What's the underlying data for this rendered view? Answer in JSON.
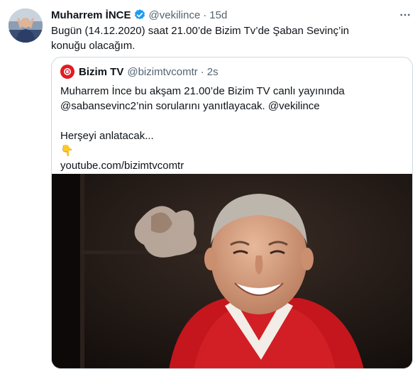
{
  "tweet": {
    "author_name": "Muharrem İNCE",
    "author_handle": "@vekilince",
    "separator": "·",
    "time": "15d",
    "text": "Bugün (14.12.2020) saat 21.00’de Bizim Tv’de Şaban Sevinç’in konuğu olacağım."
  },
  "quote": {
    "author_name": "Bizim TV",
    "author_handle": "@bizimtvcomtr",
    "separator": "·",
    "time": "2s",
    "text_line_1": "Muharrem İnce bu akşam 21.00’de Bizim TV canlı yayınında",
    "text_line_2": "@sabansevinc2’nin sorularını yanıtlayacak. @vekilince",
    "text_line_3": "Herşeyi anlatacak...",
    "emoji": "👇",
    "link": "youtube.com/bizimtvcomtr"
  },
  "icons": {
    "verified": "verified-badge-icon",
    "more": "more-options-icon"
  },
  "colors": {
    "text_primary": "#0f1419",
    "text_secondary": "#536471",
    "verified_blue": "#1d9bf0",
    "border": "#cfd9de",
    "brand_red": "#e31b23"
  }
}
